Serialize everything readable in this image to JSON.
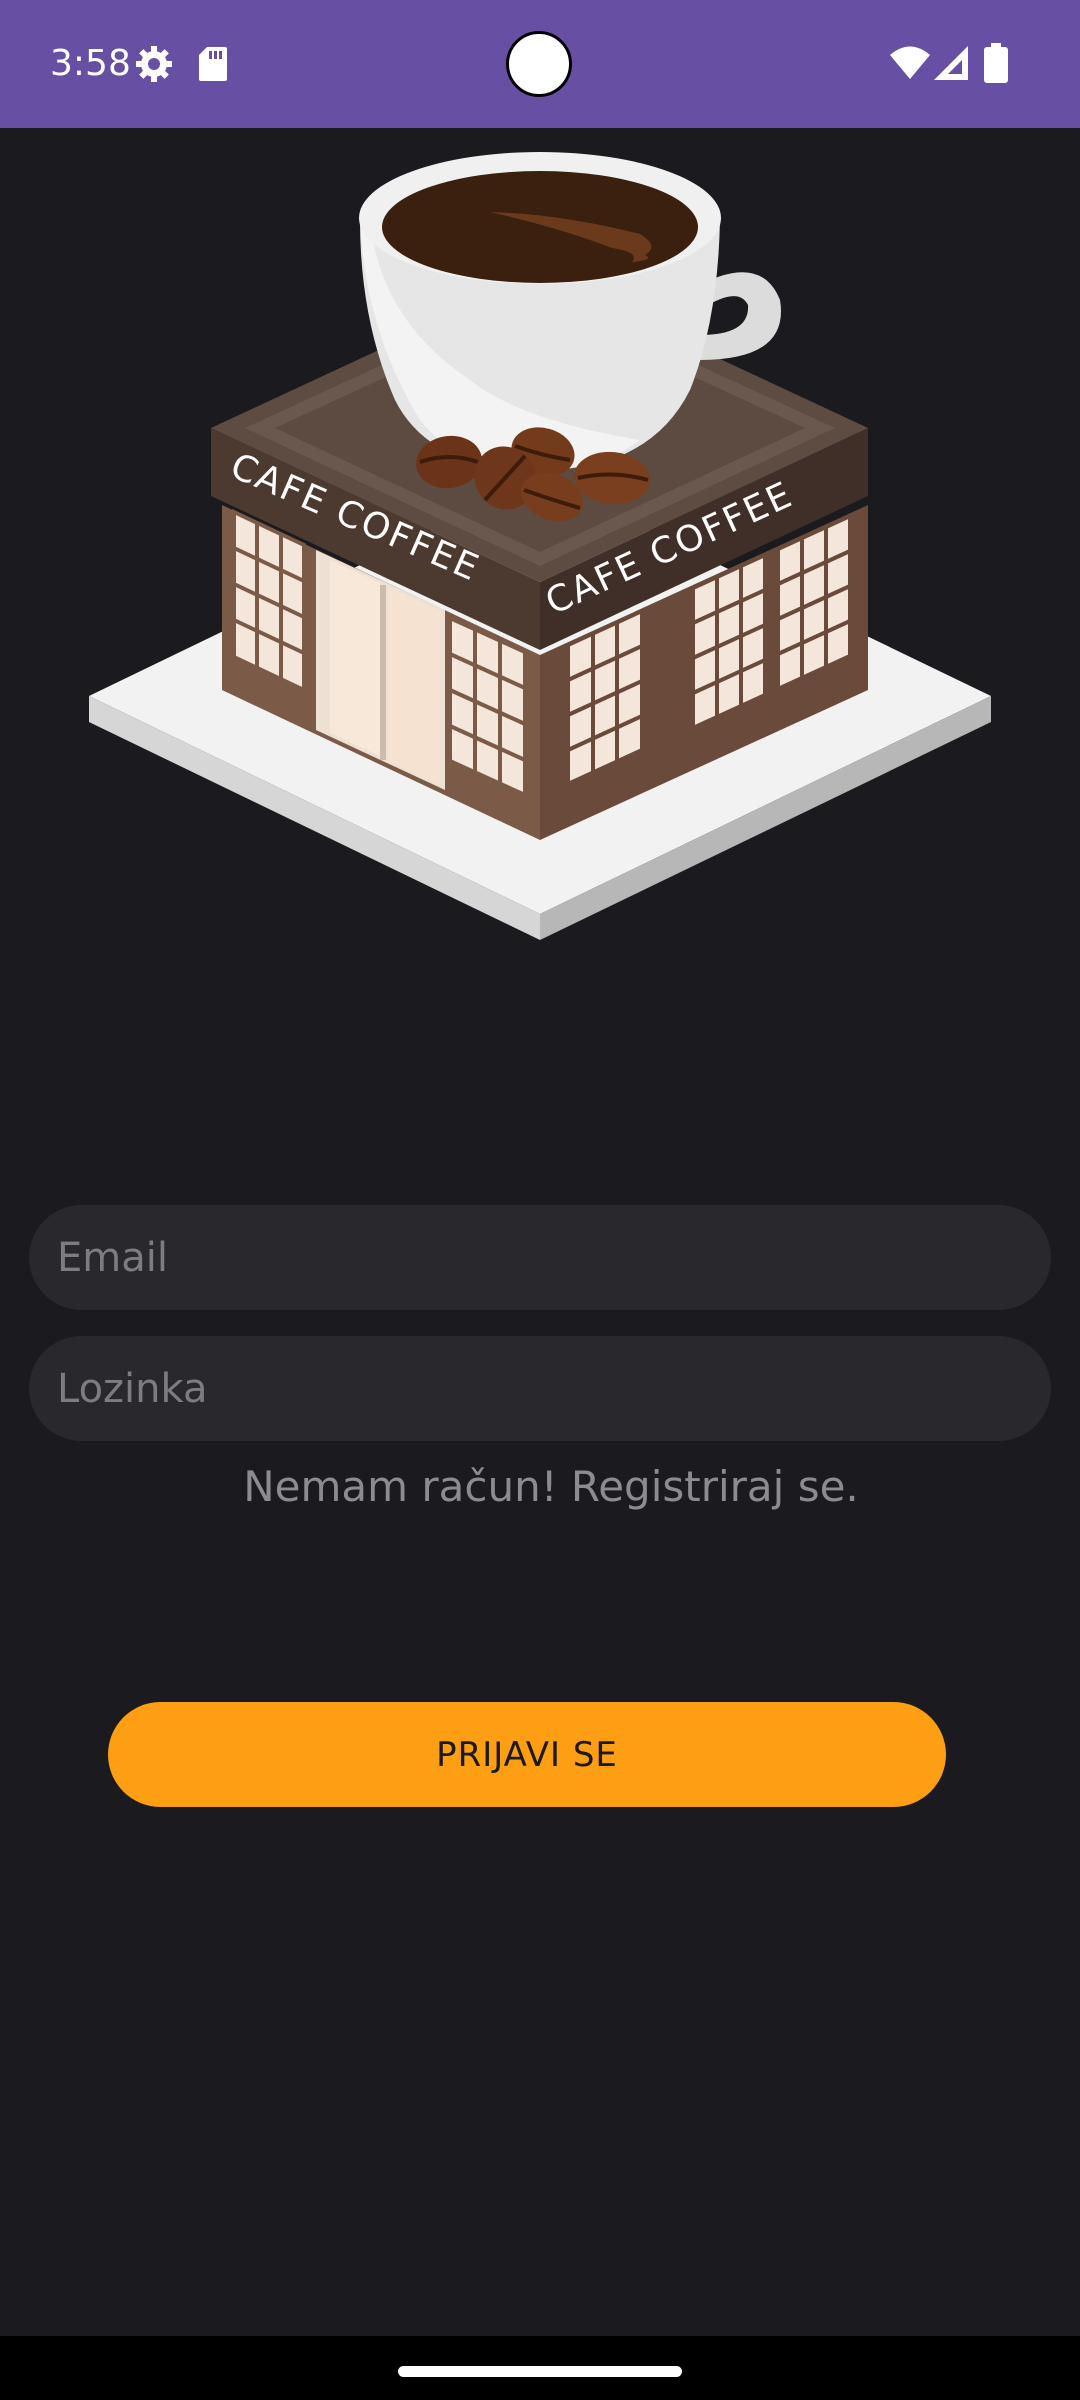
{
  "status_bar": {
    "time": "3:58",
    "icons": [
      "settings-gear-icon",
      "sd-card-icon",
      "wifi-icon",
      "cellular-signal-icon",
      "battery-icon"
    ],
    "background": "#6750a4"
  },
  "illustration": {
    "sign_left": "CAFE COFFEE",
    "sign_right": "CAFE COFFEE"
  },
  "form": {
    "email_placeholder": "Email",
    "password_placeholder": "Lozinka",
    "register_link": "Nemam račun! Registriraj se.",
    "login_button": "PRIJAVI SE"
  },
  "colors": {
    "background": "#1b1a1f",
    "field_background": "#29282d",
    "accent": "#fe9e12",
    "placeholder_text": "#7d7c81"
  }
}
